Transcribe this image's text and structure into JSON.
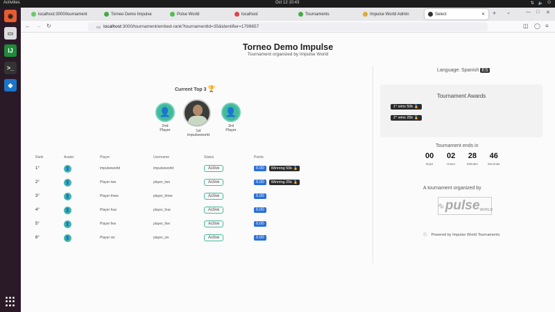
{
  "topbar": {
    "activities": "Activities",
    "clock": "Oct 12 10:43"
  },
  "browser": {
    "tabs": [
      {
        "label": "localhost:3000/tournament"
      },
      {
        "label": "Torneo Demo Impulse"
      },
      {
        "label": "Pulse World"
      },
      {
        "label": "localhost"
      },
      {
        "label": "Tournaments"
      },
      {
        "label": "Impulse World Admin"
      },
      {
        "label": "Select"
      }
    ],
    "url_host": "localhost",
    "url_path": ":3000/tournament/embed-rank?tournamentId=35&identifier=1799657"
  },
  "header": {
    "title": "Torneo Demo Impulse",
    "subtitle": "Tournament organized by Impulse World"
  },
  "podium": {
    "title": "Current Top 3",
    "first": {
      "place": "1st",
      "name": "impulseworld"
    },
    "second": {
      "place": "2nd",
      "name": "Player"
    },
    "third": {
      "place": "3rd",
      "name": "Player"
    }
  },
  "table": {
    "headers": [
      "Rank",
      "Avatar",
      "Player",
      "Username",
      "Status",
      "Points"
    ],
    "rows": [
      {
        "rank": "1°",
        "player": "impulseworld",
        "user": "impulseworld",
        "status": "Active",
        "points": "0.00",
        "award": "Winning 50k 🏅"
      },
      {
        "rank": "2°",
        "player": "Player two",
        "user": "player_two",
        "status": "Active",
        "points": "0.00",
        "award": "Winning 25k 🏅"
      },
      {
        "rank": "3°",
        "player": "Player three",
        "user": "player_three",
        "status": "Active",
        "points": "0.00",
        "award": ""
      },
      {
        "rank": "4°",
        "player": "Player four",
        "user": "player_four",
        "status": "Active",
        "points": "0.00",
        "award": ""
      },
      {
        "rank": "5°",
        "player": "Player five",
        "user": "player_five",
        "status": "Active",
        "points": "0.00",
        "award": ""
      },
      {
        "rank": "6°",
        "player": "Player six",
        "user": "player_six",
        "status": "Active",
        "points": "0.00",
        "award": ""
      }
    ]
  },
  "sidebar": {
    "language": "Language: Spanish",
    "awards_title": "Tournament Awards",
    "awards": [
      "1° wins 50k 🏅",
      "2° wins 25k 🏅"
    ],
    "countdown_title": "Tournament ends in",
    "countdown": [
      {
        "v": "00",
        "u": "Days"
      },
      {
        "v": "02",
        "u": "Hours"
      },
      {
        "v": "28",
        "u": "Minutes"
      },
      {
        "v": "46",
        "u": "Seconds"
      }
    ],
    "organized": "A tournament organized by",
    "sponsor": "pulse",
    "sponsor_sub": "WORLD",
    "footer": "Powered by Impulse World Tournaments"
  },
  "colors": {
    "accent": "#43b99d",
    "points": "#2a6fd6",
    "dark": "#2b2b2b"
  }
}
